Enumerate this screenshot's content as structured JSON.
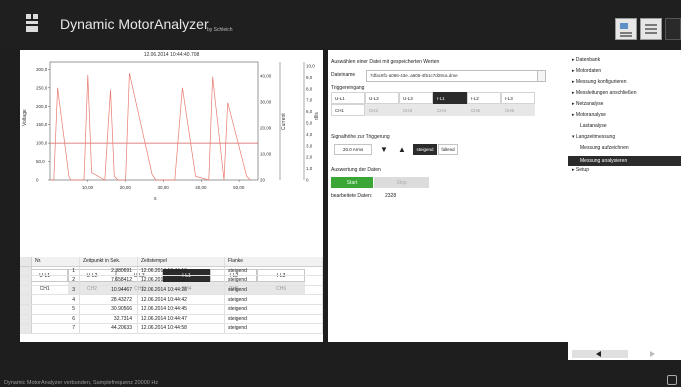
{
  "app": {
    "title": "Dynamic MotorAnalyzer",
    "subtitle": "by Schleich",
    "toolbar_icons": [
      "report-icon",
      "window-icon",
      "panel-icon"
    ]
  },
  "chart": {
    "timestamp": "12.06.2014 10:44:40.708",
    "left_axis_label": "Voltage",
    "right_axis1_label": "Current",
    "right_axis2_label": "dl/s"
  },
  "chart_data": {
    "type": "line",
    "x": [
      0,
      1,
      2,
      5,
      5.5,
      9,
      10,
      11,
      14.5,
      16,
      17,
      18,
      20,
      21,
      27,
      28,
      33,
      35,
      38.5,
      42,
      43,
      46,
      47,
      52,
      53
    ],
    "x_ticks": [
      "10,00",
      "20,00",
      "30,00",
      "40,00",
      "50,00"
    ],
    "x_label": "s",
    "y_left_ticks": [
      "300,0",
      "250,0",
      "200,0",
      "150,0",
      "100,0",
      "50,0",
      "0"
    ],
    "y_right1_ticks": [
      "40,00",
      "30,00",
      "20,00",
      "10,00",
      "20"
    ],
    "y_right2_ticks": [
      "10,0",
      "9,0",
      "8,0",
      "7,0",
      "6,0",
      "5,0",
      "4,0",
      "3,0",
      "2,0",
      "1,0",
      "0"
    ],
    "series": [
      {
        "color": "#e8796f",
        "values": [
          0,
          0,
          250,
          10,
          0,
          0,
          285,
          20,
          0,
          245,
          10,
          0,
          0,
          290,
          15,
          0,
          0,
          250,
          10,
          0,
          280,
          0,
          210,
          10,
          0
        ]
      }
    ],
    "reference_line": {
      "value": 100,
      "color": "#d65b58"
    }
  },
  "channels": {
    "row1": [
      "U-L1",
      "U-L2",
      "U-L3",
      "I-L1",
      "I-L2",
      "I-L3"
    ],
    "row2": [
      "CH1",
      "CH2",
      "CH3",
      "CH4",
      "CH5",
      "CH6"
    ],
    "selected_index": 3
  },
  "table": {
    "headers": [
      "Nr.",
      "Zeitpunkt in Sek.",
      "Zeitstempel",
      "Flanke"
    ],
    "rows": [
      [
        "1",
        "2.380691",
        "12.06.2014 10:44:16",
        "steigend"
      ],
      [
        "2",
        "7.658412",
        "12.06.2014 10:44:21",
        "steigend"
      ],
      [
        "3",
        "10.94467",
        "12.06.2014 10:44:28",
        "steigend"
      ],
      [
        "4",
        "28.43272",
        "12.06.2014 10:44:42",
        "steigend"
      ],
      [
        "5",
        "30.90566",
        "12.06.2014 10:44:45",
        "steigend"
      ],
      [
        "6",
        "32.7314",
        "12.06.2014 10:44:47",
        "steigend"
      ],
      [
        "7",
        "44.20633",
        "12.06.2014 10:44:58",
        "steigend"
      ]
    ]
  },
  "middle": {
    "section_title": "Auswählen einer Datei mit gespeicherten Werten",
    "dateiname_label": "Dateiname",
    "dateiname_value": "7dfac8f1-a066-43e..a605-4f61c7d29ca.dme",
    "triggereingang_label": "Triggereingang",
    "trig_row1": [
      "U-L1",
      "U-L2",
      "U-L3",
      "I-L1",
      "I-L2",
      "I-L3"
    ],
    "trig_row2": [
      "CH1",
      "CH2",
      "CH3",
      "CH4",
      "CH5",
      "CH6"
    ],
    "trig_selected_index": 3,
    "signalhoehe_label": "Signalhöhe zur Triggerung",
    "signalhoehe_value": "20.0 Arms",
    "edge_rising": "steigend",
    "edge_falling": "fallend",
    "auswertung_label": "Auswertung der Daten",
    "start_label": "Start",
    "stop_label": "Stop",
    "bearbeitete_label": "bearbeitete Daten:",
    "bearbeitete_value": "2328"
  },
  "nav": {
    "items": [
      {
        "label": "Datenbank",
        "level": 0
      },
      {
        "label": "Motordaten",
        "level": 0
      },
      {
        "label": "Messung konfigurieren",
        "level": 0
      },
      {
        "label": "Messleitungen anschließen",
        "level": 0
      },
      {
        "label": "Netzanalyse",
        "level": 0
      },
      {
        "label": "Motoranalyse",
        "level": 0
      },
      {
        "label": "Lastanalyse",
        "level": 1
      },
      {
        "label": "Langzeitmessung",
        "level": 0
      },
      {
        "label": "Messung aufzeichnen",
        "level": 1
      },
      {
        "label": "Messung analysieren",
        "level": 1,
        "active": true
      },
      {
        "label": "Setup",
        "level": 0
      }
    ]
  },
  "status": {
    "text": "Dynamic MotorAnalyzer verbunden, Samplefrequenz 20000 Hz"
  }
}
